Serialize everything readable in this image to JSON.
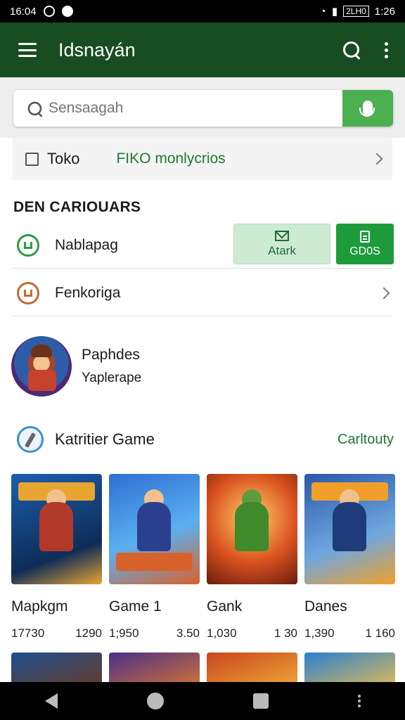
{
  "status_bar": {
    "time": "16:04",
    "battery": "2LH0",
    "clock": "1:26"
  },
  "app_bar": {
    "title": "Idsnayán"
  },
  "search": {
    "placeholder": "Sensaagah"
  },
  "filter": {
    "checkbox_label": "Toko",
    "link_label": "FIKO monlycrios"
  },
  "section": {
    "heading": "DEN CARIOUARS"
  },
  "rows": [
    {
      "label": "Nablapag",
      "icon": "shield-check-icon",
      "actions": {
        "attack_label": "Atark",
        "games_label": "GD0S"
      }
    },
    {
      "label": "Fenkoriga",
      "icon": "shield-icon"
    }
  ],
  "profile": {
    "name": "Paphdes",
    "subtitle": "Yaplerape"
  },
  "game_section": {
    "title": "Katritier Game",
    "link": "Carltouty"
  },
  "games": [
    {
      "name": "Mapkgm",
      "stat_left": "17730",
      "stat_right": "1290",
      "colors": [
        "#1b5fb0",
        "#e8a531"
      ]
    },
    {
      "name": "Game 1",
      "stat_left": "1;950",
      "stat_right": "3.50",
      "colors": [
        "#2f6fd3",
        "#d8622c"
      ]
    },
    {
      "name": "Gank",
      "stat_left": "1,030",
      "stat_right": "1 30",
      "colors": [
        "#d9521f",
        "#3f8a2a"
      ]
    },
    {
      "name": "Danes",
      "stat_left": "1,390",
      "stat_right": "1 160",
      "colors": [
        "#2a58a8",
        "#f0a02a"
      ]
    }
  ],
  "colors": {
    "app_bar": "#184d22",
    "accent": "#1d9b3a",
    "link": "#1e7a30",
    "mic": "#4caf50"
  }
}
